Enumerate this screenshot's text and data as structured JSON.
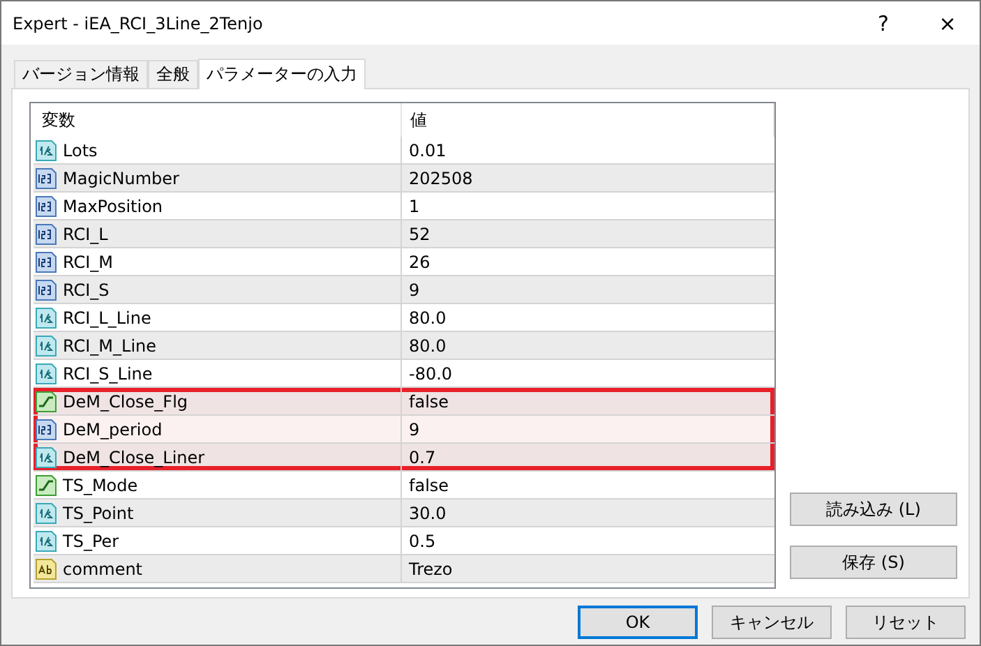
{
  "window": {
    "title": "Expert - iEA_RCI_3Line_2Tenjo",
    "help": "?",
    "close": "×"
  },
  "tabs": [
    {
      "label": "バージョン情報",
      "selected": false
    },
    {
      "label": "全般",
      "selected": false
    },
    {
      "label": "パラメーターの入力",
      "selected": true
    }
  ],
  "table": {
    "columns": [
      "変数",
      "値"
    ],
    "rows": [
      {
        "kind": "double",
        "name": "Lots",
        "value": "0.01",
        "highlighted": false
      },
      {
        "kind": "int",
        "name": "MagicNumber",
        "value": "202508",
        "highlighted": false
      },
      {
        "kind": "int",
        "name": "MaxPosition",
        "value": "1",
        "highlighted": false
      },
      {
        "kind": "int",
        "name": "RCI_L",
        "value": "52",
        "highlighted": false
      },
      {
        "kind": "int",
        "name": "RCI_M",
        "value": "26",
        "highlighted": false
      },
      {
        "kind": "int",
        "name": "RCI_S",
        "value": "9",
        "highlighted": false
      },
      {
        "kind": "double",
        "name": "RCI_L_Line",
        "value": "80.0",
        "highlighted": false
      },
      {
        "kind": "double",
        "name": "RCI_M_Line",
        "value": "80.0",
        "highlighted": false
      },
      {
        "kind": "double",
        "name": "RCI_S_Line",
        "value": "-80.0",
        "highlighted": false
      },
      {
        "kind": "bool",
        "name": "DeM_Close_Flg",
        "value": "false",
        "highlighted": true
      },
      {
        "kind": "int",
        "name": "DeM_period",
        "value": "9",
        "highlighted": true
      },
      {
        "kind": "double",
        "name": "DeM_Close_Liner",
        "value": "0.7",
        "highlighted": true
      },
      {
        "kind": "bool",
        "name": "TS_Mode",
        "value": "false",
        "highlighted": false
      },
      {
        "kind": "double",
        "name": "TS_Point",
        "value": "30.0",
        "highlighted": false
      },
      {
        "kind": "double",
        "name": "TS_Per",
        "value": "0.5",
        "highlighted": false
      },
      {
        "kind": "string",
        "name": "comment",
        "value": "Trezo",
        "highlighted": false
      }
    ]
  },
  "side_buttons": [
    "読み込み (L)",
    "保存 (S)"
  ],
  "footer_buttons": [
    {
      "label": "OK",
      "default": true
    },
    {
      "label": "キャンセル",
      "default": false
    },
    {
      "label": "リセット",
      "default": false
    }
  ]
}
